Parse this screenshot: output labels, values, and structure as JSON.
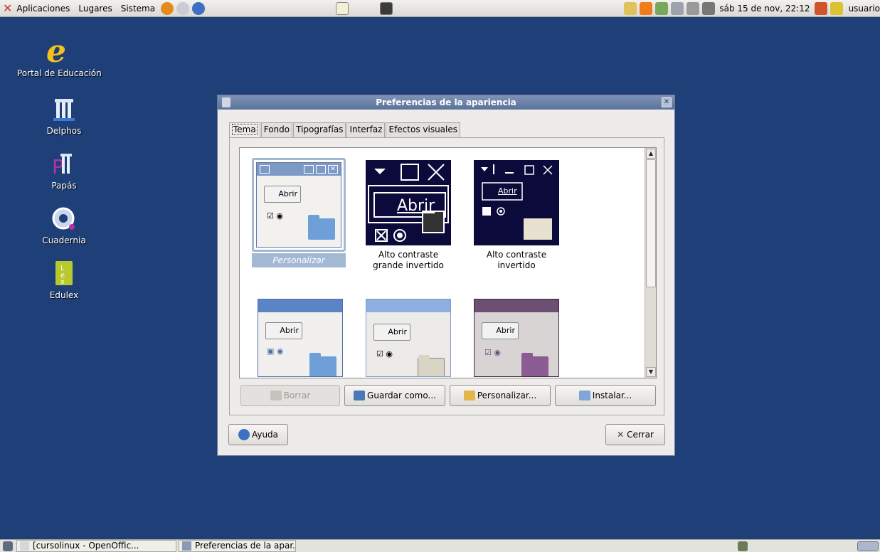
{
  "top_panel": {
    "menus": [
      "Aplicaciones",
      "Lugares",
      "Sistema"
    ],
    "clock": "sáb 15 de nov, 22:12",
    "user": "usuario"
  },
  "desktop": {
    "icons": [
      {
        "label": "Portal de Educación",
        "icon": "education-portal-icon"
      },
      {
        "label": "Delphos",
        "icon": "delphos-icon"
      },
      {
        "label": "Papás",
        "icon": "papas-icon"
      },
      {
        "label": "Cuadernia",
        "icon": "cuadernia-icon"
      },
      {
        "label": "Edulex",
        "icon": "edulex-icon"
      }
    ]
  },
  "window": {
    "title": "Preferencias de la apariencia",
    "tabs": [
      "Tema",
      "Fondo",
      "Tipografías",
      "Interfaz",
      "Efectos visuales"
    ],
    "active_tab": "Tema",
    "themes": [
      {
        "label": "Personalizar",
        "selected": true
      },
      {
        "label": "Alto contraste grande invertido",
        "line1": "Alto contraste",
        "line2": "grande invertido"
      },
      {
        "label": "Alto contraste invertido",
        "line1": "Alto contraste",
        "line2": "invertido"
      }
    ],
    "sample_button": "Abrir",
    "buttons": {
      "delete": "Borrar",
      "save_as": "Guardar como...",
      "customize": "Personalizar...",
      "install": "Instalar..."
    },
    "help": "Ayuda",
    "close": "Cerrar"
  },
  "taskbar": {
    "tasks": [
      "[cursolinux - OpenOffic...",
      "Preferencias de la apar..."
    ]
  }
}
